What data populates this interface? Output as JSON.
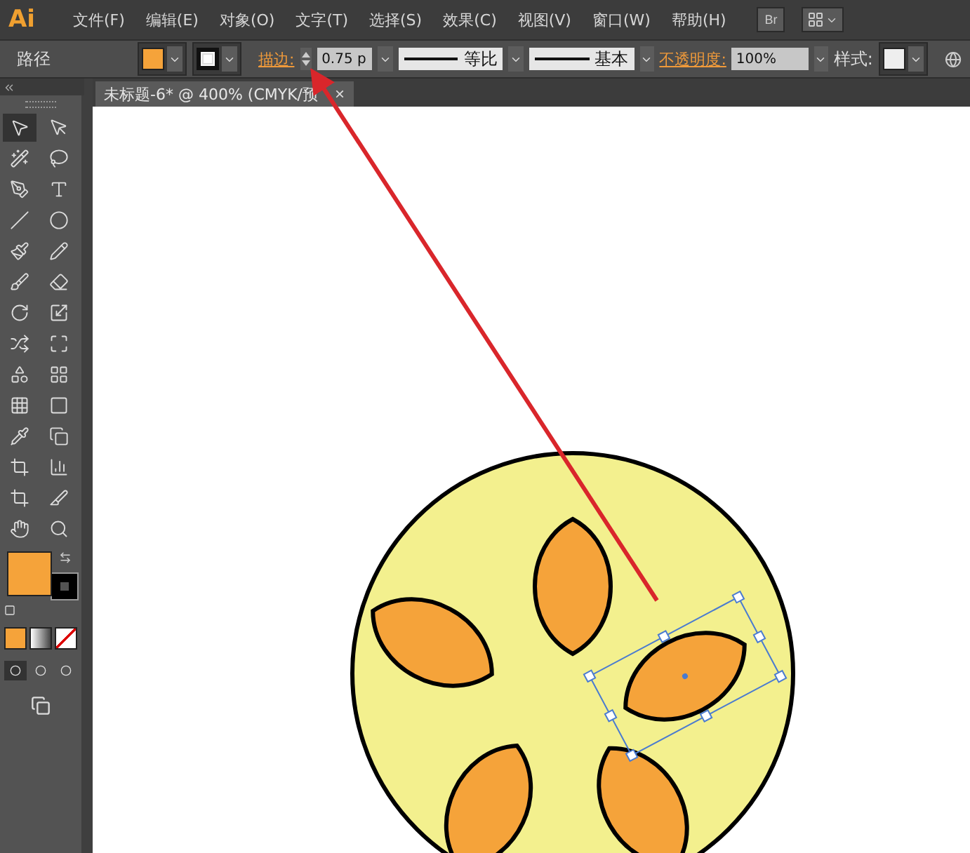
{
  "app": {
    "logo": "Ai",
    "bridge_button": "Br"
  },
  "menu": [
    "文件(F)",
    "编辑(E)",
    "对象(O)",
    "文字(T)",
    "选择(S)",
    "效果(C)",
    "视图(V)",
    "窗口(W)",
    "帮助(H)"
  ],
  "control_bar": {
    "selection_label": "路径",
    "stroke_label": "描边:",
    "stroke_weight": "0.75 p",
    "profile": "等比",
    "brush": "基本",
    "opacity_label": "不透明度:",
    "opacity": "100%",
    "style_label": "样式:"
  },
  "document_tab": {
    "title": "未标题-6* @ 400% (CMYK/预",
    "close": "×"
  }
}
